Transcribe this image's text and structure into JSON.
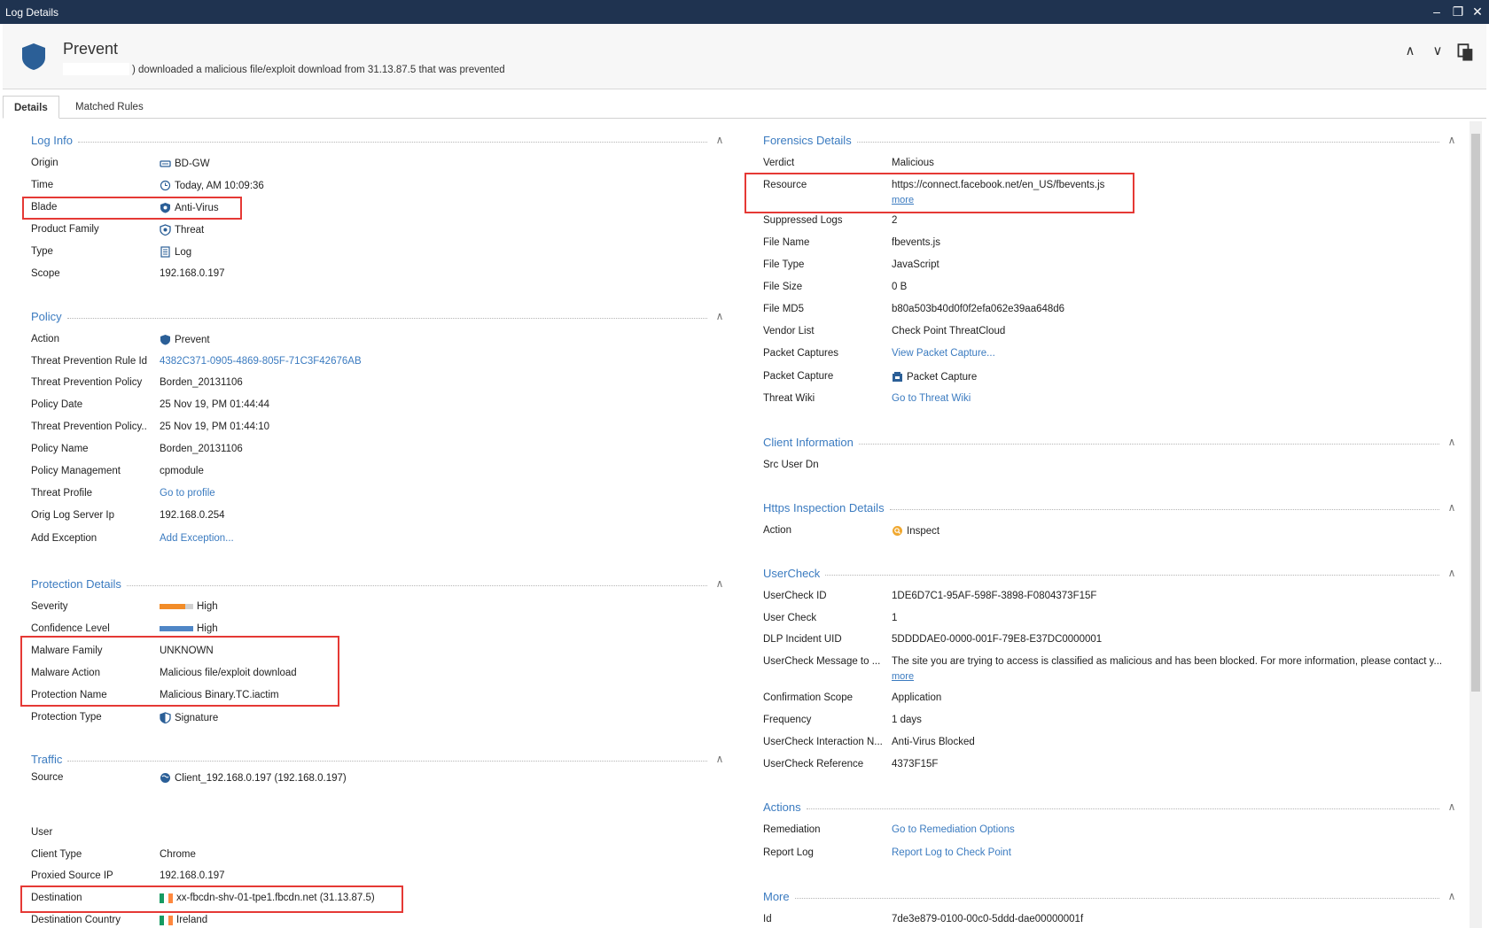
{
  "window": {
    "title": "Log Details",
    "minimize": "–",
    "restore": "❐",
    "close": "✕"
  },
  "header": {
    "title": "Prevent",
    "description": ") downloaded a malicious file/exploit download from 31.13.87.5 that was prevented",
    "up": "∧",
    "down": "∨"
  },
  "tabs": [
    "Details",
    "Matched Rules"
  ],
  "log_info": {
    "title": "Log Info",
    "rows": [
      {
        "label": "Origin",
        "value": "BD-GW",
        "icon": "gateway-icon"
      },
      {
        "label": "Time",
        "value": "Today, AM 10:09:36",
        "icon": "clock-icon"
      },
      {
        "label": "Blade",
        "value": "Anti-Virus",
        "icon": "antivirus-icon"
      },
      {
        "label": "Product Family",
        "value": "Threat",
        "icon": "threat-shield-icon"
      },
      {
        "label": "Type",
        "value": "Log",
        "icon": "log-icon"
      },
      {
        "label": "Scope",
        "value": "192.168.0.197"
      }
    ]
  },
  "policy": {
    "title": "Policy",
    "rows": [
      {
        "label": "Action",
        "value": "Prevent",
        "icon": "shield-icon"
      },
      {
        "label": "Threat Prevention Rule Id",
        "value": "4382C371-0905-4869-805F-71C3F42676AB",
        "link": true
      },
      {
        "label": "Threat Prevention Policy",
        "value": "Borden_20131106"
      },
      {
        "label": "Policy Date",
        "value": "25 Nov 19, PM 01:44:44"
      },
      {
        "label": "Threat Prevention Policy..",
        "value": "25 Nov 19, PM 01:44:10"
      },
      {
        "label": "Policy Name",
        "value": "Borden_20131106"
      },
      {
        "label": "Policy Management",
        "value": "cpmodule"
      },
      {
        "label": "Threat Profile",
        "value": "Go to profile",
        "link": true
      },
      {
        "label": "Orig Log Server Ip",
        "value": "192.168.0.254"
      },
      {
        "label": "Add Exception",
        "value": "Add Exception...",
        "link": true
      }
    ]
  },
  "protection": {
    "title": "Protection Details",
    "rows": [
      {
        "label": "Severity",
        "value": "High",
        "bar": "severity"
      },
      {
        "label": "Confidence Level",
        "value": "High",
        "bar": "confidence"
      },
      {
        "label": "Malware Family",
        "value": "UNKNOWN"
      },
      {
        "label": "Malware Action",
        "value": "Malicious file/exploit download"
      },
      {
        "label": "Protection Name",
        "value": "Malicious Binary.TC.iactim"
      },
      {
        "label": "Protection Type",
        "value": "Signature",
        "icon": "signature-icon"
      }
    ]
  },
  "traffic": {
    "title": "Traffic",
    "rows": [
      {
        "label": "Source",
        "value": "Client_192.168.0.197 (192.168.0.197)",
        "icon": "globe-icon"
      },
      {
        "label": "User",
        "value": ""
      },
      {
        "label": "Client Type",
        "value": "Chrome"
      },
      {
        "label": "Proxied Source IP",
        "value": "192.168.0.197"
      },
      {
        "label": "Destination",
        "value": "xx-fbcdn-shv-01-tpe1.fbcdn.net (31.13.87.5)",
        "icon": "ireland-flag-icon"
      },
      {
        "label": "Destination Country",
        "value": "Ireland",
        "icon": "ireland-flag-icon"
      }
    ]
  },
  "forensics": {
    "title": "Forensics Details",
    "rows": [
      {
        "label": "Verdict",
        "value": "Malicious"
      },
      {
        "label": "Resource",
        "value": "https://connect.facebook.net/en_US/fbevents.js",
        "more": "more"
      },
      {
        "label": "Suppressed Logs",
        "value": "2"
      },
      {
        "label": "File Name",
        "value": "fbevents.js"
      },
      {
        "label": "File Type",
        "value": "JavaScript"
      },
      {
        "label": "File Size",
        "value": "0 B"
      },
      {
        "label": "File MD5",
        "value": "b80a503b40d0f0f2efa062e39aa648d6"
      },
      {
        "label": "Vendor List",
        "value": "Check Point ThreatCloud"
      },
      {
        "label": "Packet Captures",
        "value": "View Packet Capture...",
        "link": true
      },
      {
        "label": "Packet Capture",
        "value": "Packet Capture",
        "icon": "packet-capture-icon"
      },
      {
        "label": "Threat Wiki",
        "value": "Go to Threat Wiki",
        "link": true
      }
    ]
  },
  "client_info": {
    "title": "Client Information",
    "rows": [
      {
        "label": "Src User Dn",
        "value": ""
      }
    ]
  },
  "https_inspection": {
    "title": "Https Inspection Details",
    "rows": [
      {
        "label": "Action",
        "value": "Inspect",
        "icon": "inspect-icon"
      }
    ]
  },
  "usercheck": {
    "title": "UserCheck",
    "rows": [
      {
        "label": "UserCheck ID",
        "value": "1DE6D7C1-95AF-598F-3898-F0804373F15F"
      },
      {
        "label": "User Check",
        "value": "1"
      },
      {
        "label": "DLP Incident UID",
        "value": "5DDDDAE0-0000-001F-79E8-E37DC0000001"
      },
      {
        "label": "UserCheck Message to ...",
        "value": "The site you are trying to access is classified as malicious and has been blocked. For more information, please contact y...",
        "more": "more"
      },
      {
        "label": "Confirmation Scope",
        "value": "Application"
      },
      {
        "label": "Frequency",
        "value": "1 days"
      },
      {
        "label": "UserCheck Interaction N...",
        "value": "Anti-Virus Blocked"
      },
      {
        "label": "UserCheck Reference",
        "value": "4373F15F"
      }
    ]
  },
  "actions": {
    "title": "Actions",
    "rows": [
      {
        "label": "Remediation",
        "value": "Go to Remediation Options",
        "link": true
      },
      {
        "label": "Report Log",
        "value": "Report Log to Check Point",
        "link": true
      }
    ]
  },
  "more_section": {
    "title": "More",
    "rows": [
      {
        "label": "Id",
        "value": "7de3e879-0100-00c0-5ddd-dae00000001f"
      }
    ]
  },
  "colors": {
    "accent": "#3b7bc0",
    "titlebar": "#1f3350",
    "highlight": "#e53935",
    "severity": "#f28c28",
    "confidence": "#4f86c6"
  }
}
